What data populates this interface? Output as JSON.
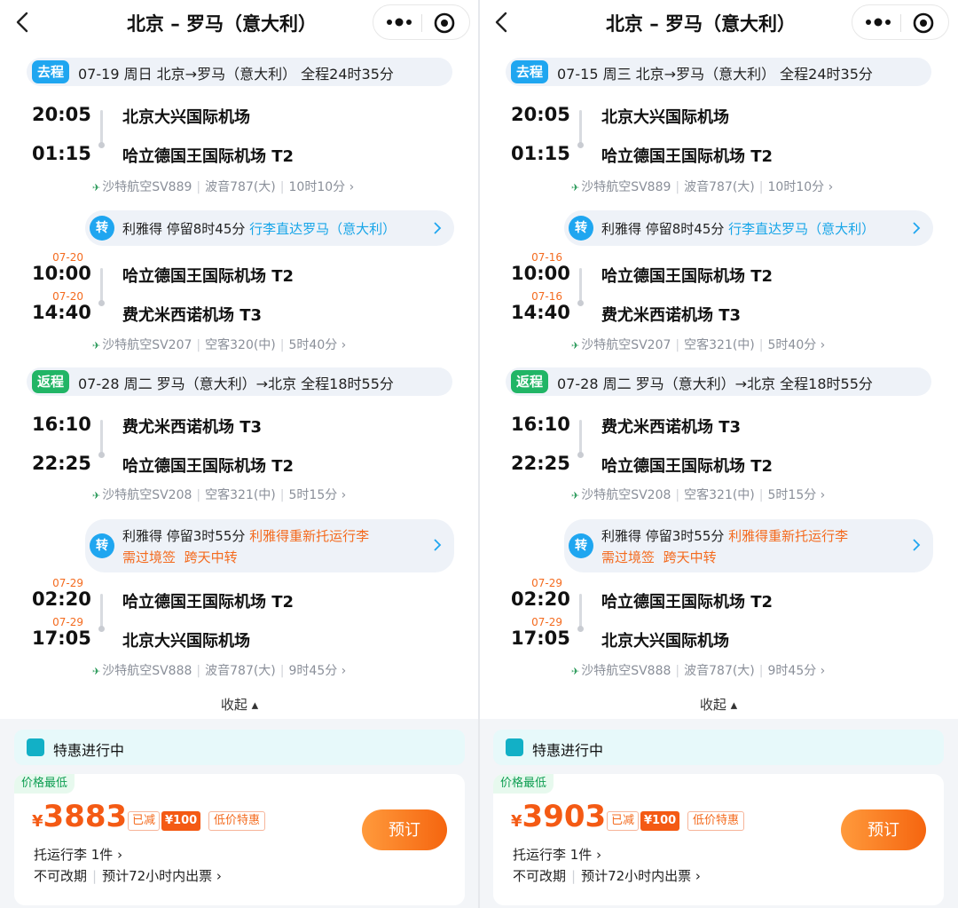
{
  "header": {
    "title": "北京 – 罗马（意大利）"
  },
  "labels": {
    "outbound_badge": "去程",
    "return_badge": "返程",
    "transfer_badge": "转",
    "collapse": "收起 ▴",
    "promo": "特惠进行中",
    "lowest_tag": "价格最低",
    "reduced": "已减",
    "discount": "¥100",
    "low_price": "低价特惠",
    "book": "预订",
    "baggage": "托运行李 1件 ›",
    "no_change": "不可改期",
    "ticketing": "预计72小时内出票 ›",
    "currency": "¥"
  },
  "colors": {
    "accent_blue": "#1fa6f0",
    "accent_green": "#21b566",
    "price_orange": "#f45a14"
  },
  "panels": [
    {
      "outbound": {
        "summary": "07-19 周日  北京→罗马（意大利）   全程24时35分"
      },
      "leg1": {
        "dep_time": "20:05",
        "dep_airport": "北京大兴国际机场",
        "arr_time": "01:15",
        "arr_airport": "哈立德国王国际机场 T2",
        "meta_airline": "沙特航空SV889",
        "meta_aircraft": "波音787(大)",
        "meta_duration": "10时10分 ›"
      },
      "transfer1": {
        "line1_prefix": "利雅得 停留8时45分 ",
        "line1_highlight": "行李直达罗马（意大利）",
        "line2_a": "",
        "line2_b": ""
      },
      "leg2": {
        "dep_date": "07-20",
        "dep_time": "10:00",
        "dep_airport": "哈立德国王国际机场 T2",
        "arr_date": "07-20",
        "arr_time": "14:40",
        "arr_airport": "费尤米西诺机场 T3",
        "meta_airline": "沙特航空SV207",
        "meta_aircraft": "空客320(中)",
        "meta_duration": "5时40分 ›"
      },
      "return": {
        "summary": "07-28 周二  罗马（意大利）→北京  全程18时55分"
      },
      "leg3": {
        "dep_time": "16:10",
        "dep_airport": "费尤米西诺机场 T3",
        "arr_time": "22:25",
        "arr_airport": "哈立德国王国际机场 T2",
        "meta_airline": "沙特航空SV208",
        "meta_aircraft": "空客321(中)",
        "meta_duration": "5时15分 ›"
      },
      "transfer2": {
        "line1_prefix": "利雅得 停留3时55分 ",
        "line1_highlight": "利雅得重新托运行李",
        "line2_a": "需过境签",
        "line2_b": "跨天中转"
      },
      "leg4": {
        "dep_date": "07-29",
        "dep_time": "02:20",
        "dep_airport": "哈立德国王国际机场 T2",
        "arr_date": "07-29",
        "arr_time": "17:05",
        "arr_airport": "北京大兴国际机场",
        "meta_airline": "沙特航空SV888",
        "meta_aircraft": "波音787(大)",
        "meta_duration": "9时45分 ›"
      },
      "price": "3883"
    },
    {
      "outbound": {
        "summary": "07-15 周三  北京→罗马（意大利）   全程24时35分"
      },
      "leg1": {
        "dep_time": "20:05",
        "dep_airport": "北京大兴国际机场",
        "arr_time": "01:15",
        "arr_airport": "哈立德国王国际机场 T2",
        "meta_airline": "沙特航空SV889",
        "meta_aircraft": "波音787(大)",
        "meta_duration": "10时10分 ›"
      },
      "transfer1": {
        "line1_prefix": "利雅得 停留8时45分 ",
        "line1_highlight": "行李直达罗马（意大利）",
        "line2_a": "",
        "line2_b": ""
      },
      "leg2": {
        "dep_date": "07-16",
        "dep_time": "10:00",
        "dep_airport": "哈立德国王国际机场 T2",
        "arr_date": "07-16",
        "arr_time": "14:40",
        "arr_airport": "费尤米西诺机场 T3",
        "meta_airline": "沙特航空SV207",
        "meta_aircraft": "空客321(中)",
        "meta_duration": "5时40分 ›"
      },
      "return": {
        "summary": "07-28 周二  罗马（意大利）→北京  全程18时55分"
      },
      "leg3": {
        "dep_time": "16:10",
        "dep_airport": "费尤米西诺机场 T3",
        "arr_time": "22:25",
        "arr_airport": "哈立德国王国际机场 T2",
        "meta_airline": "沙特航空SV208",
        "meta_aircraft": "空客321(中)",
        "meta_duration": "5时15分 ›"
      },
      "transfer2": {
        "line1_prefix": "利雅得 停留3时55分 ",
        "line1_highlight": "利雅得重新托运行李",
        "line2_a": "需过境签",
        "line2_b": "跨天中转"
      },
      "leg4": {
        "dep_date": "07-29",
        "dep_time": "02:20",
        "dep_airport": "哈立德国王国际机场 T2",
        "arr_date": "07-29",
        "arr_time": "17:05",
        "arr_airport": "北京大兴国际机场",
        "meta_airline": "沙特航空SV888",
        "meta_aircraft": "波音787(大)",
        "meta_duration": "9时45分 ›"
      },
      "price": "3903"
    }
  ]
}
